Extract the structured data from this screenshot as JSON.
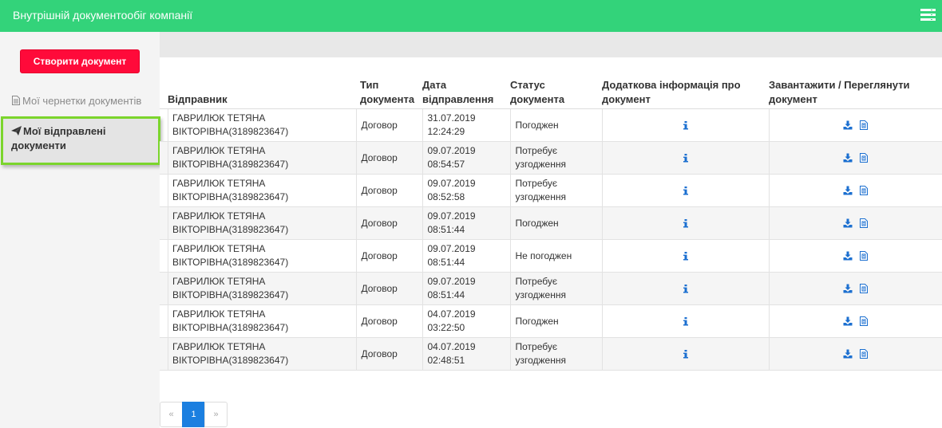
{
  "header": {
    "title": "Внутрішній документообіг компанії",
    "menu_icon": "menu-icon"
  },
  "sidebar": {
    "create_label": "Створити документ",
    "drafts_label": "Мої чернетки документів",
    "sent_label": "Мої відправлені документи"
  },
  "table": {
    "columns": [
      "Відправник",
      "Тип документа",
      "Дата відправлення",
      "Статус документа",
      "Додаткова інформація про документ",
      "Завантажити / Переглянути документ"
    ],
    "rows": [
      {
        "sender": "ГАВРИЛЮК ТЕТЯНА ВІКТОРІВНА(3189823647)",
        "type": "Договор",
        "date": "31.07.2019",
        "time": "12:24:29",
        "status": "Погоджен"
      },
      {
        "sender": "ГАВРИЛЮК ТЕТЯНА ВІКТОРІВНА(3189823647)",
        "type": "Договор",
        "date": "09.07.2019",
        "time": "08:54:57",
        "status": "Потребує узгодження"
      },
      {
        "sender": "ГАВРИЛЮК ТЕТЯНА ВІКТОРІВНА(3189823647)",
        "type": "Договор",
        "date": "09.07.2019",
        "time": "08:52:58",
        "status": "Потребує узгодження"
      },
      {
        "sender": "ГАВРИЛЮК ТЕТЯНА ВІКТОРІВНА(3189823647)",
        "type": "Договор",
        "date": "09.07.2019",
        "time": "08:51:44",
        "status": "Погоджен"
      },
      {
        "sender": "ГАВРИЛЮК ТЕТЯНА ВІКТОРІВНА(3189823647)",
        "type": "Договор",
        "date": "09.07.2019",
        "time": "08:51:44",
        "status": "Не погоджен"
      },
      {
        "sender": "ГАВРИЛЮК ТЕТЯНА ВІКТОРІВНА(3189823647)",
        "type": "Договор",
        "date": "09.07.2019",
        "time": "08:51:44",
        "status": "Потребує узгодження"
      },
      {
        "sender": "ГАВРИЛЮК ТЕТЯНА ВІКТОРІВНА(3189823647)",
        "type": "Договор",
        "date": "04.07.2019",
        "time": "03:22:50",
        "status": "Погоджен"
      },
      {
        "sender": "ГАВРИЛЮК ТЕТЯНА ВІКТОРІВНА(3189823647)",
        "type": "Договор",
        "date": "04.07.2019",
        "time": "02:48:51",
        "status": "Потребує узгодження"
      }
    ]
  },
  "pagination": {
    "prev": "«",
    "current": "1",
    "next": "»"
  },
  "colors": {
    "header": "#33d37a",
    "create_button": "#ff0a3a",
    "active_highlight": "#7bd52c",
    "link": "#1b7fe0"
  }
}
